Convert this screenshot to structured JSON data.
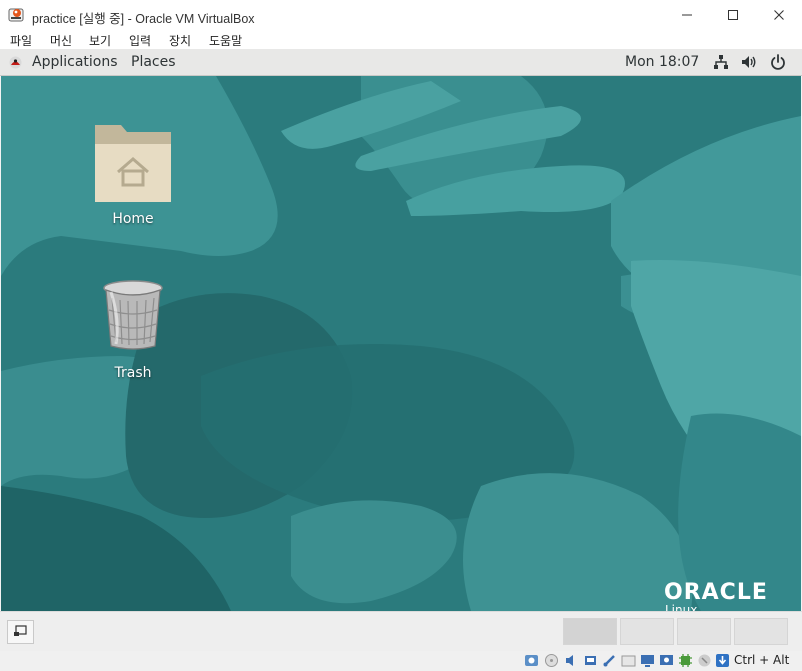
{
  "window": {
    "title": "practice [실행 중] - Oracle VM VirtualBox",
    "controls": {
      "minimize": "—",
      "maximize": "☐",
      "close": "✕"
    }
  },
  "menubar": {
    "items": [
      "파일",
      "머신",
      "보기",
      "입력",
      "장치",
      "도움말"
    ]
  },
  "gnome": {
    "applications": "Applications",
    "places": "Places",
    "clock": "Mon 18:07",
    "icons": [
      "network-icon",
      "volume-icon",
      "power-icon"
    ]
  },
  "desktop": {
    "icons": [
      {
        "label": "Home",
        "icon": "home-folder-icon"
      },
      {
        "label": "Trash",
        "icon": "trash-icon"
      }
    ],
    "brand": {
      "word": "ORACLE",
      "sub": "Linux"
    }
  },
  "vbox": {
    "host_key": "Ctrl + Alt",
    "workspaces": 4
  }
}
